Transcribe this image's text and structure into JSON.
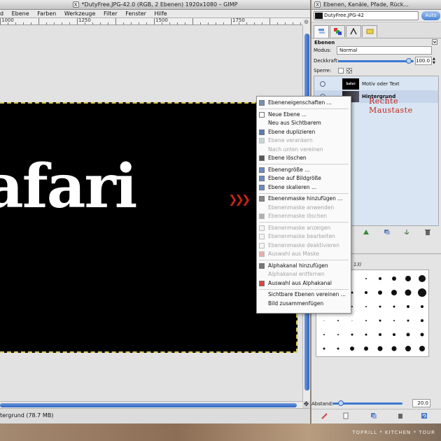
{
  "main_window": {
    "title": "*DutyFree.JPG-42.0 (RGB, 2 Ebenen) 1920x1080 – GIMP",
    "menus": [
      "d",
      "Ebene",
      "Farben",
      "Werkzeuge",
      "Filter",
      "Fenster",
      "Hilfe"
    ],
    "ruler_labels": [
      "1000",
      "1250",
      "1500",
      "1750"
    ],
    "canvas_text": "afari",
    "status_text": "tergrund (78.7 MB)"
  },
  "annotation": {
    "label": "Rechte Maustaste",
    "color": "#c0281c"
  },
  "context_menu": {
    "items": [
      {
        "label": "Ebeneneigenschaften ...",
        "enabled": true,
        "icon": "layer-properties-icon"
      },
      {
        "label": "Neue Ebene ...",
        "enabled": true,
        "icon": "new-layer-icon"
      },
      {
        "label": "Neu aus Sichtbarem",
        "enabled": true,
        "icon": ""
      },
      {
        "label": "Ebene duplizieren",
        "enabled": true,
        "icon": "duplicate-icon"
      },
      {
        "label": "Ebene verankern",
        "enabled": false,
        "icon": "anchor-icon"
      },
      {
        "label": "Nach unten vereinen",
        "enabled": false,
        "icon": ""
      },
      {
        "label": "Ebene löschen",
        "enabled": true,
        "icon": "trash-icon"
      },
      {
        "label": "Ebenengröße ...",
        "enabled": true,
        "icon": "layer-size-icon"
      },
      {
        "label": "Ebene auf Bildgröße",
        "enabled": true,
        "icon": "layer-to-image-icon"
      },
      {
        "label": "Ebene skalieren ...",
        "enabled": true,
        "icon": "scale-icon"
      },
      {
        "label": "Ebenenmaske hinzufügen ...",
        "enabled": true,
        "icon": "add-mask-icon"
      },
      {
        "label": "Ebenenmaske anwenden",
        "enabled": false,
        "icon": ""
      },
      {
        "label": "Ebenenmaske löschen",
        "enabled": false,
        "icon": "trash-icon"
      },
      {
        "label": "Ebenenmaske anzeigen",
        "enabled": false,
        "icon": "checkbox-icon"
      },
      {
        "label": "Ebenenmaske bearbeiten",
        "enabled": false,
        "icon": "checkbox-icon"
      },
      {
        "label": "Ebenenmaske deaktivieren",
        "enabled": false,
        "icon": "checkbox-icon"
      },
      {
        "label": "Auswahl aus Maske",
        "enabled": false,
        "icon": "selection-icon"
      },
      {
        "label": "Alphakanal hinzufügen",
        "enabled": true,
        "icon": "alpha-icon"
      },
      {
        "label": "Alphakanal entfernen",
        "enabled": false,
        "icon": ""
      },
      {
        "label": "Auswahl aus Alphakanal",
        "enabled": true,
        "icon": "alpha-selection-icon"
      },
      {
        "label": "Sichtbare Ebenen vereinen ...",
        "enabled": true,
        "icon": ""
      },
      {
        "label": "Bild zusammenfügen",
        "enabled": true,
        "icon": ""
      }
    ]
  },
  "dock": {
    "title": "Ebenen, Kanäle, Pfade, Rück...",
    "image_selector": "DutyFree.JPG-42",
    "auto_button": "Auto",
    "section_title": "Ebenen",
    "modus_label": "Modus:",
    "modus_value": "Normal",
    "opacity_label": "Deckkraft:",
    "opacity_value": "100.0",
    "opacity_fraction": 1.0,
    "lock_label": "Sperre:",
    "layers": [
      {
        "name": "Motiv oder Text",
        "thumb_text": "Safari",
        "selected": false
      },
      {
        "name": "Hintergrund",
        "thumb_text": "",
        "selected": true
      }
    ],
    "brush_label": "13)",
    "spacing_label": "Abstand:",
    "spacing_value": "20.0",
    "spacing_fraction": 0.2
  },
  "footer": {
    "text": "TOPRILL * KITCHEN * TOUR"
  }
}
